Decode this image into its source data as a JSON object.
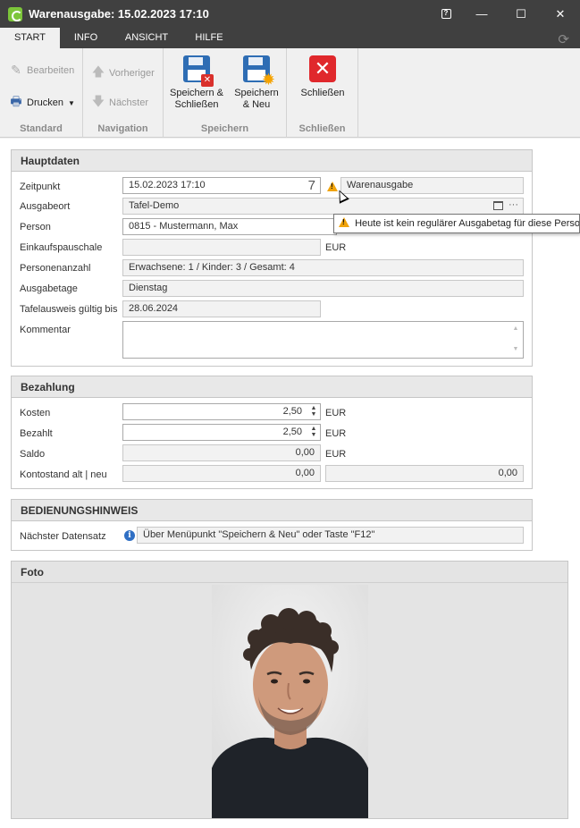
{
  "window": {
    "title": "Warenausgabe: 15.02.2023 17:10",
    "help_label": "?",
    "minimize_label": "—",
    "maximize_label": "☐",
    "close_label": "✕"
  },
  "tabs": [
    {
      "label": "START"
    },
    {
      "label": "INFO"
    },
    {
      "label": "ANSICHT"
    },
    {
      "label": "HILFE"
    }
  ],
  "ribbon": {
    "standard": {
      "label": "Standard",
      "edit": "Bearbeiten",
      "print": "Drucken"
    },
    "navigation": {
      "label": "Navigation",
      "previous": "Vorheriger",
      "next": "Nächster"
    },
    "save": {
      "label": "Speichern",
      "save_close_1": "Speichern &",
      "save_close_2": "Schließen",
      "save_new_1": "Speichern",
      "save_new_2": "& Neu"
    },
    "close": {
      "label": "Schließen",
      "close_btn": "Schließen"
    }
  },
  "hauptdaten": {
    "title": "Hauptdaten",
    "zeitpunkt_label": "Zeitpunkt",
    "zeitpunkt_value": "15.02.2023 17:10",
    "zeitpunkt_weekday": "7",
    "typ_value": "Warenausgabe",
    "ausgabeort_label": "Ausgabeort",
    "ausgabeort_value": "Tafel-Demo",
    "ausgabeort_more": "···",
    "person_label": "Person",
    "person_value": "0815 - Mustermann, Max",
    "einkauf_label": "Einkaufspauschale",
    "einkauf_value": "",
    "einkauf_unit": "EUR",
    "personen_label": "Personenanzahl",
    "personen_value": "Erwachsene: 1 / Kinder: 3 / Gesamt: 4",
    "ausgabetage_label": "Ausgabetage",
    "ausgabetage_value": "Dienstag",
    "ausweis_label": "Tafelausweis gültig bis",
    "ausweis_value": "28.06.2024",
    "kommentar_label": "Kommentar",
    "kommentar_value": ""
  },
  "tooltip": {
    "text": "Heute ist kein regulärer Ausgabetag für diese Person"
  },
  "bezahlung": {
    "title": "Bezahlung",
    "kosten_label": "Kosten",
    "kosten_value": "2,50",
    "kosten_unit": "EUR",
    "bezahlt_label": "Bezahlt",
    "bezahlt_value": "2,50",
    "bezahlt_unit": "EUR",
    "saldo_label": "Saldo",
    "saldo_value": "0,00",
    "saldo_unit": "EUR",
    "konto_label": "Kontostand alt | neu",
    "konto_alt": "0,00",
    "konto_neu": "0,00"
  },
  "hinweis": {
    "title": "BEDIENUNGSHINWEIS",
    "label": "Nächster Datensatz",
    "text": "Über Menüpunkt \"Speichern & Neu\" oder Taste \"F12\""
  },
  "foto": {
    "title": "Foto"
  },
  "colors": {
    "titlebar": "#404040",
    "accent_blue": "#2e6db4",
    "close_red": "#e0282c",
    "warning": "#f0a30a"
  },
  "icons": {
    "app": "app-logo-icon",
    "edit": "pencil-icon",
    "print": "printer-icon",
    "previous": "arrow-up-icon",
    "next": "arrow-down-icon",
    "save_close": "floppy-close-icon",
    "save_new": "floppy-new-icon",
    "close": "close-x-icon",
    "refresh": "refresh-icon",
    "warning": "warning-icon",
    "info": "info-icon"
  }
}
